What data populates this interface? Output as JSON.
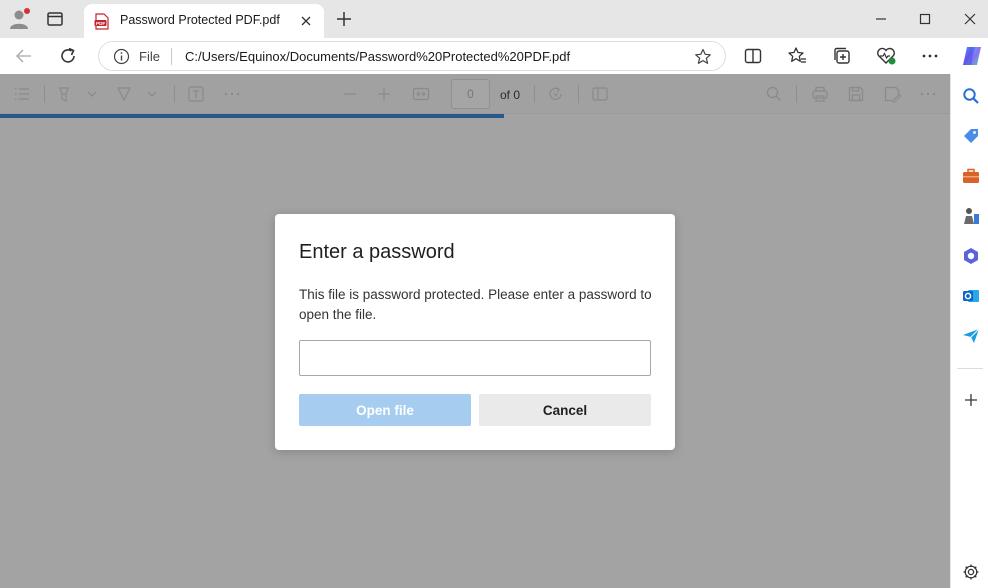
{
  "browser": {
    "tab": {
      "title": "Password Protected PDF.pdf",
      "icon": "pdf-file-icon"
    },
    "address": {
      "scheme_label": "File",
      "url": "C:/Users/Equinox/Documents/Password%20Protected%20PDF.pdf"
    },
    "window_controls": [
      "minimize-icon",
      "maximize-icon",
      "close-icon"
    ],
    "sidebar_icons": [
      "search-icon",
      "tag-icon",
      "toolbox-icon",
      "chess-icon",
      "copilot-icon",
      "outlook-icon",
      "send-icon",
      "add-icon",
      "settings-icon"
    ]
  },
  "pdf_toolbar": {
    "page_number": "0",
    "page_total": "of 0",
    "load_progress_percent": 53
  },
  "dialog": {
    "title": "Enter a password",
    "message": "This file is password protected. Please enter a password to open the file.",
    "password_value": "",
    "open_label": "Open file",
    "cancel_label": "Cancel"
  },
  "colors": {
    "accent_blue": "#27588a",
    "open_button_disabled": "#a6cdf0",
    "overlay_gray": "#a3a3a3"
  }
}
